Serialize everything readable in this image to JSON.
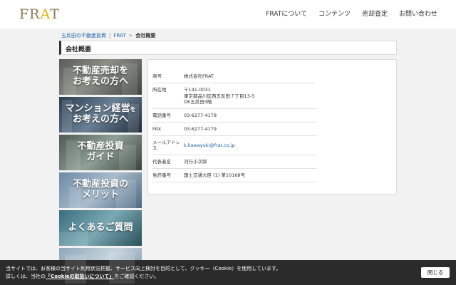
{
  "header": {
    "logo": {
      "pre": "FR",
      "hl": "A",
      "post": "T"
    },
    "nav": [
      "FRATについて",
      "コンテンツ",
      "売却査定",
      "お問い合わせ"
    ]
  },
  "breadcrumb": {
    "items": [
      "五反田の不動産投資",
      "FRAT"
    ],
    "current": "会社概要"
  },
  "page_title": "会社概要",
  "sidebar": {
    "banners": [
      {
        "line1": "不動産売却を",
        "line2": "お考えの方へ"
      },
      {
        "line1a": "マンション経営",
        "line1b": "を",
        "line2": "お考えの方へ"
      },
      {
        "line1": "不動産投資",
        "line2": "ガイド"
      },
      {
        "line1": "不動産投資の",
        "line2": "メリット"
      },
      {
        "line1": "よくあるご質問",
        "line2": ""
      },
      {
        "line1": "",
        "line2": ""
      }
    ]
  },
  "company": {
    "rows": [
      {
        "label": "商号",
        "value": "株式会社FRAT"
      },
      {
        "label": "所在地",
        "value1": "〒141-0031",
        "value2": "東京都品川区西五反田７丁目13-5",
        "value3": "DK五反田3階"
      },
      {
        "label": "電話番号",
        "value": "03-6277-4178"
      },
      {
        "label": "FAX",
        "value": "03-6277-4179"
      },
      {
        "label": "メールアドレス",
        "value": "k.kawayuki@frat.co.jp"
      },
      {
        "label": "代表者名",
        "value": "河行小次郎"
      },
      {
        "label": "免許番号",
        "value": "国土交通大臣 (1) 第10168号"
      }
    ]
  },
  "cookie": {
    "line1": "当サイトでは、お客様の当サイト利用状況把握、サービス向上検討を目的として、クッキー（Cookie）を使用しています。",
    "line2_pre": "詳しくは、当社の",
    "line2_link": "「Cookieの取扱いについて」",
    "line2_post": "をご確認ください。",
    "close_label": "閉じる"
  }
}
